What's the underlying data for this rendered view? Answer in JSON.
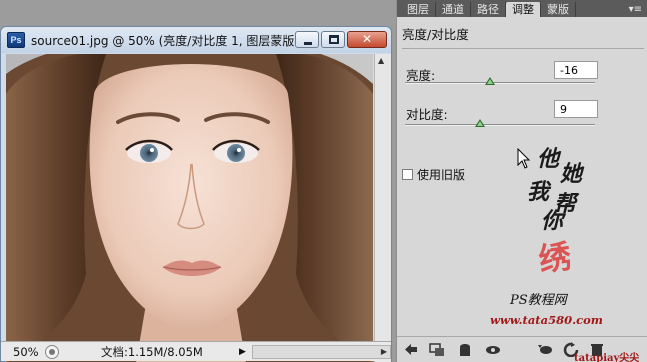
{
  "document": {
    "title": "source01.jpg @ 50% (亮度/对比度 1, 图层蒙版...",
    "zoom": "50%",
    "doc_info": "文档:1.15M/8.05M"
  },
  "panel": {
    "tabs": [
      "图层",
      "通道",
      "路径",
      "调整",
      "蒙版"
    ],
    "active_tab": "调整",
    "heading": "亮度/对比度",
    "brightness_label": "亮度:",
    "brightness_value": "-16",
    "brightness_level": -16,
    "contrast_label": "对比度:",
    "contrast_value": "9",
    "contrast_level": 9,
    "legacy_label": "使用旧版",
    "legacy_checked": false
  },
  "watermark": {
    "chars": [
      "他",
      "她",
      "我",
      "帮",
      "你"
    ],
    "seal": "绣",
    "site_name": "PS教程网",
    "url": "www.tata580.com",
    "credit": "tatapiay尖尖"
  },
  "icons": [
    "ps-app-icon",
    "minimize-icon",
    "maximize-icon",
    "close-icon",
    "zoom-info-icon",
    "arrow-right-icon",
    "scroll-up-icon",
    "scroll-down-icon",
    "back-arrow-icon",
    "clip-to-layer-icon",
    "mask-icon",
    "visibility-eye-icon",
    "view-previous-icon",
    "reset-icon",
    "trash-icon",
    "panel-menu-icon",
    "mouse-cursor-icon"
  ],
  "colors": {
    "slider_thumb": "#2f6d2f",
    "seal": "#dc2828",
    "url": "#a01818"
  }
}
